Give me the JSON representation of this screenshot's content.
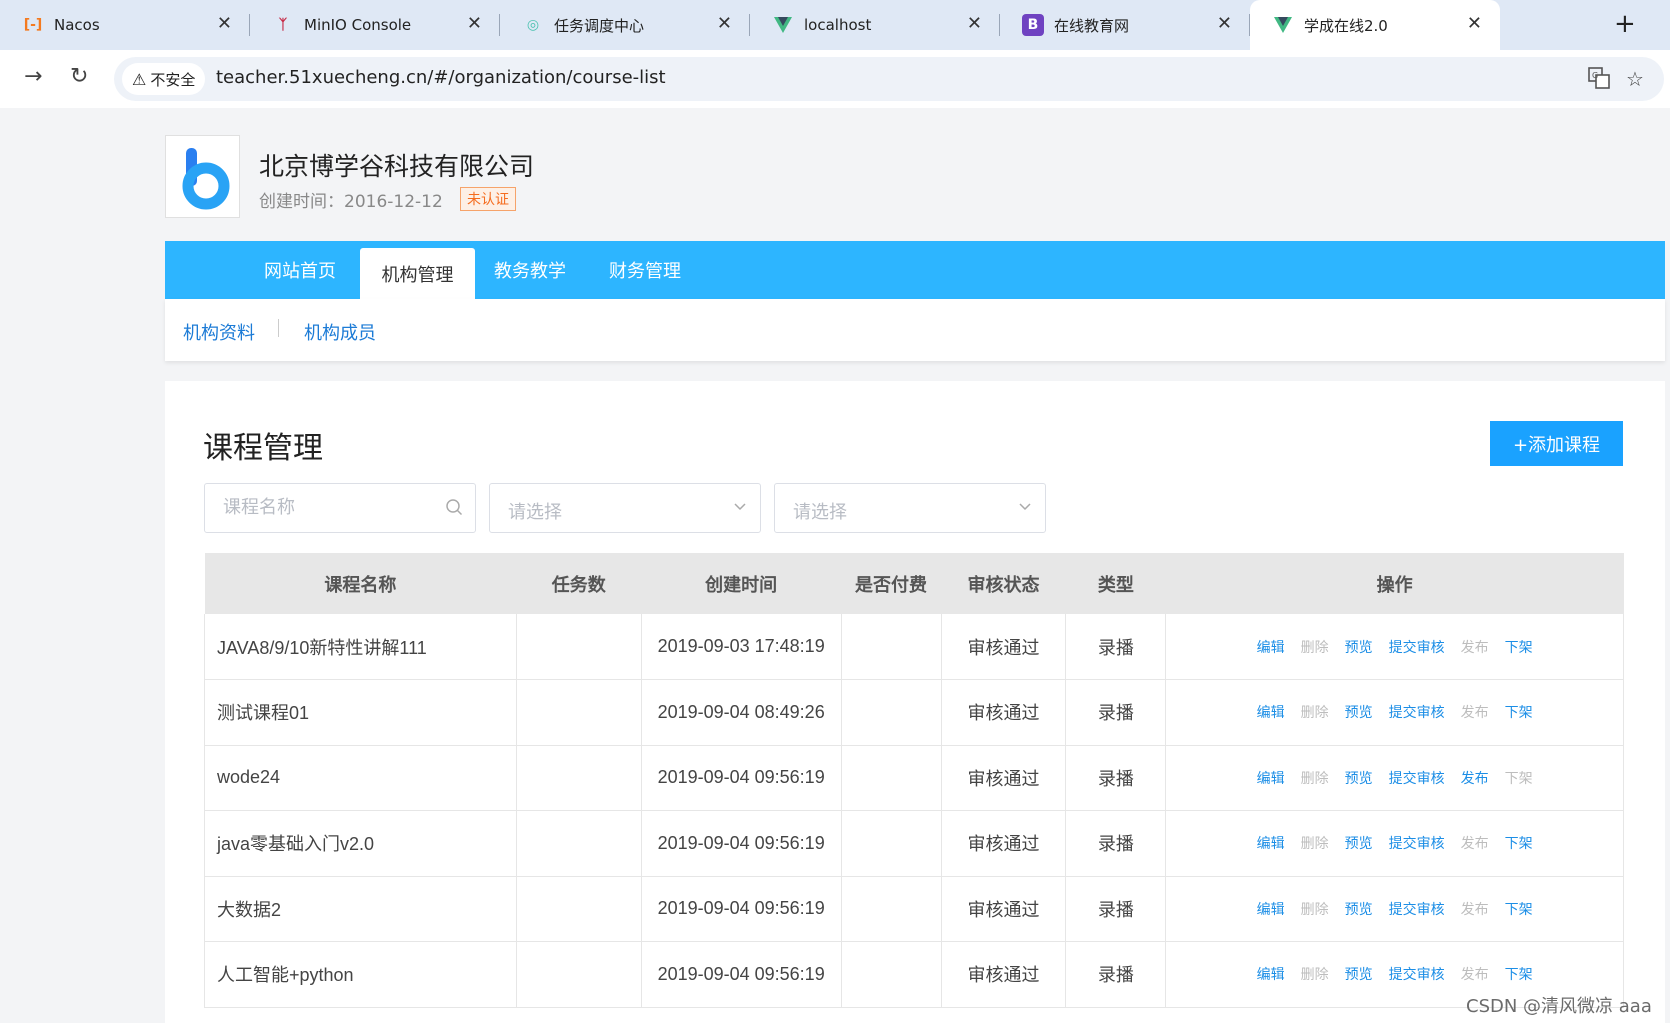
{
  "browser": {
    "tabs": [
      {
        "title": "Nacos",
        "icon": "nacos-icon",
        "color": "#f47a20"
      },
      {
        "title": "MinIO Console",
        "icon": "minio-icon",
        "color": "#c72c48"
      },
      {
        "title": "任务调度中心",
        "icon": "xxl-job-icon",
        "color": "#4cc2b0"
      },
      {
        "title": "localhost",
        "icon": "vue-icon",
        "color": "#1e8a68"
      },
      {
        "title": "在线教育网",
        "icon": "bootstrap-icon",
        "color": "#6f42c1"
      },
      {
        "title": "学成在线2.0",
        "icon": "vue-icon",
        "color": "#1e8a68"
      }
    ],
    "security_label": "不安全",
    "url": "teacher.51xuecheng.cn/#/organization/course-list"
  },
  "org": {
    "name": "北京博学谷科技有限公司",
    "created": "创建时间：2016-12-12",
    "badge": "未认证"
  },
  "topnav": [
    "网站首页",
    "机构管理",
    "教务教学",
    "财务管理"
  ],
  "subnav": [
    "机构资料",
    "机构成员"
  ],
  "page": {
    "title": "课程管理",
    "add_button": "+添加课程",
    "search_placeholder": "课程名称",
    "select_placeholder": "请选择"
  },
  "table": {
    "headers": [
      "课程名称",
      "任务数",
      "创建时间",
      "是否付费",
      "审核状态",
      "类型",
      "操作"
    ],
    "rows": [
      {
        "name": "JAVA8/9/10新特性讲解111",
        "tasks": "",
        "created": "2019-09-03 17:48:19",
        "paid": "",
        "status": "审核通过",
        "type": "录播",
        "publish_on": false,
        "offline_on": true
      },
      {
        "name": "测试课程01",
        "tasks": "",
        "created": "2019-09-04 08:49:26",
        "paid": "",
        "status": "审核通过",
        "type": "录播",
        "publish_on": false,
        "offline_on": true
      },
      {
        "name": "wode24",
        "tasks": "",
        "created": "2019-09-04 09:56:19",
        "paid": "",
        "status": "审核通过",
        "type": "录播",
        "publish_on": true,
        "offline_on": false
      },
      {
        "name": "java零基础入门v2.0",
        "tasks": "",
        "created": "2019-09-04 09:56:19",
        "paid": "",
        "status": "审核通过",
        "type": "录播",
        "publish_on": false,
        "offline_on": true
      },
      {
        "name": "大数据2",
        "tasks": "",
        "created": "2019-09-04 09:56:19",
        "paid": "",
        "status": "审核通过",
        "type": "录播",
        "publish_on": false,
        "offline_on": true
      },
      {
        "name": "人工智能+python",
        "tasks": "",
        "created": "2019-09-04 09:56:19",
        "paid": "",
        "status": "审核通过",
        "type": "录播",
        "publish_on": false,
        "offline_on": true
      }
    ],
    "ops": {
      "edit": "编辑",
      "delete": "删除",
      "preview": "预览",
      "submit": "提交审核",
      "publish": "发布",
      "offline": "下架"
    }
  },
  "watermark": "CSDN @清风微凉 aaa",
  "colors": {
    "accent": "#2db5ff",
    "link": "#1c8ee6",
    "disabled": "#bdbdbd",
    "button": "#1aa2ff"
  }
}
